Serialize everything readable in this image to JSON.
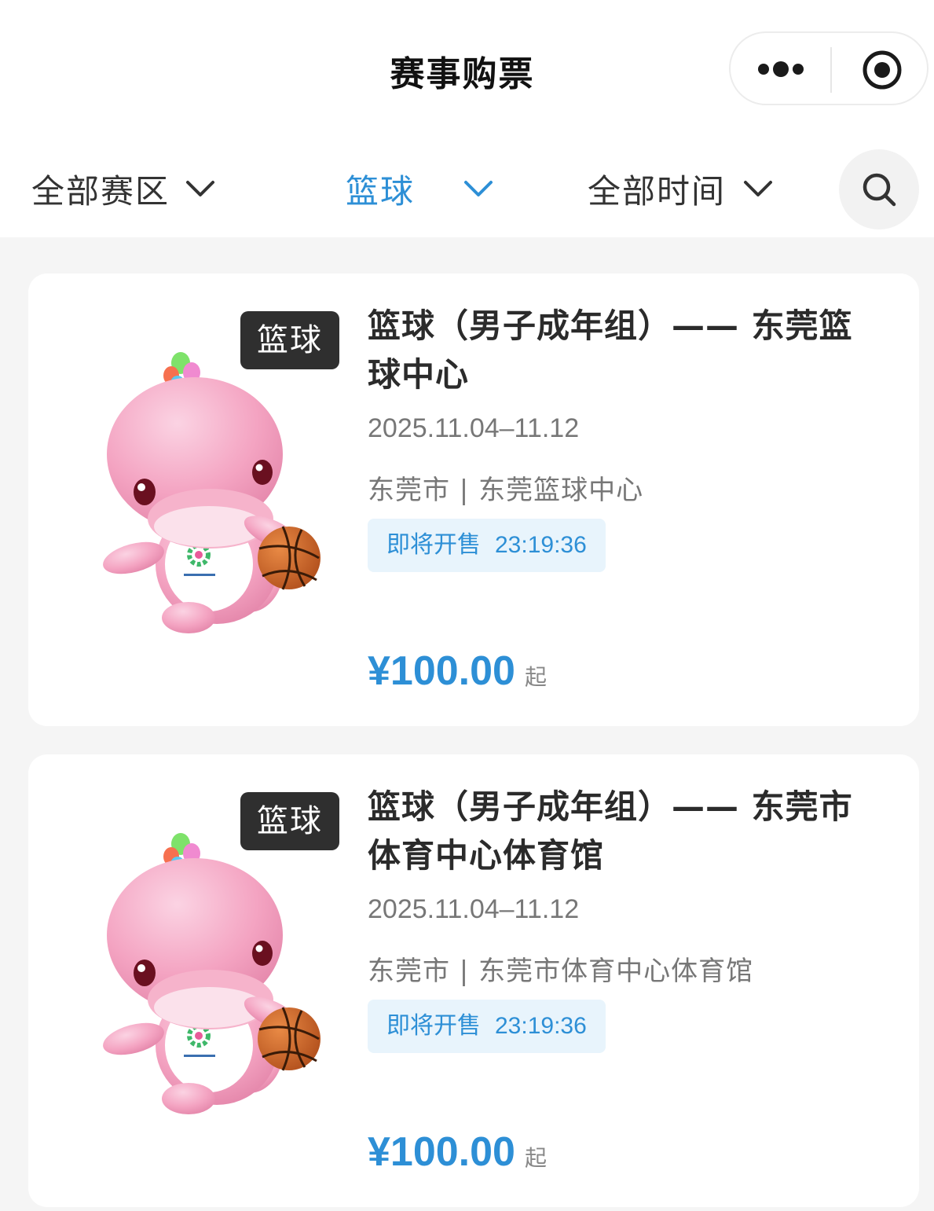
{
  "header": {
    "title": "赛事购票",
    "more_icon": "more-dots-icon",
    "close_icon": "target-circle-icon"
  },
  "filters": {
    "region": "全部赛区",
    "sport": "篮球",
    "time": "全部时间",
    "active_color": "#2d8fd6",
    "search_icon": "search-icon"
  },
  "events": [
    {
      "tag": "篮球",
      "title": "篮球（男子成年组）—— 东莞篮球中心",
      "date": "2025.11.04–11.12",
      "venue": "东莞市 | 东莞篮球中心",
      "sale_status": "即将开售",
      "countdown": "23:19:36",
      "price": "¥100.00",
      "price_suffix": "起",
      "image": "pink-dolphin-mascot-basketball"
    },
    {
      "tag": "篮球",
      "title": "篮球（男子成年组）—— 东莞市体育中心体育馆",
      "date": "2025.11.04–11.12",
      "venue": "东莞市 | 东莞市体育中心体育馆",
      "sale_status": "即将开售",
      "countdown": "23:19:36",
      "price": "¥100.00",
      "price_suffix": "起",
      "image": "pink-dolphin-mascot-basketball"
    }
  ]
}
